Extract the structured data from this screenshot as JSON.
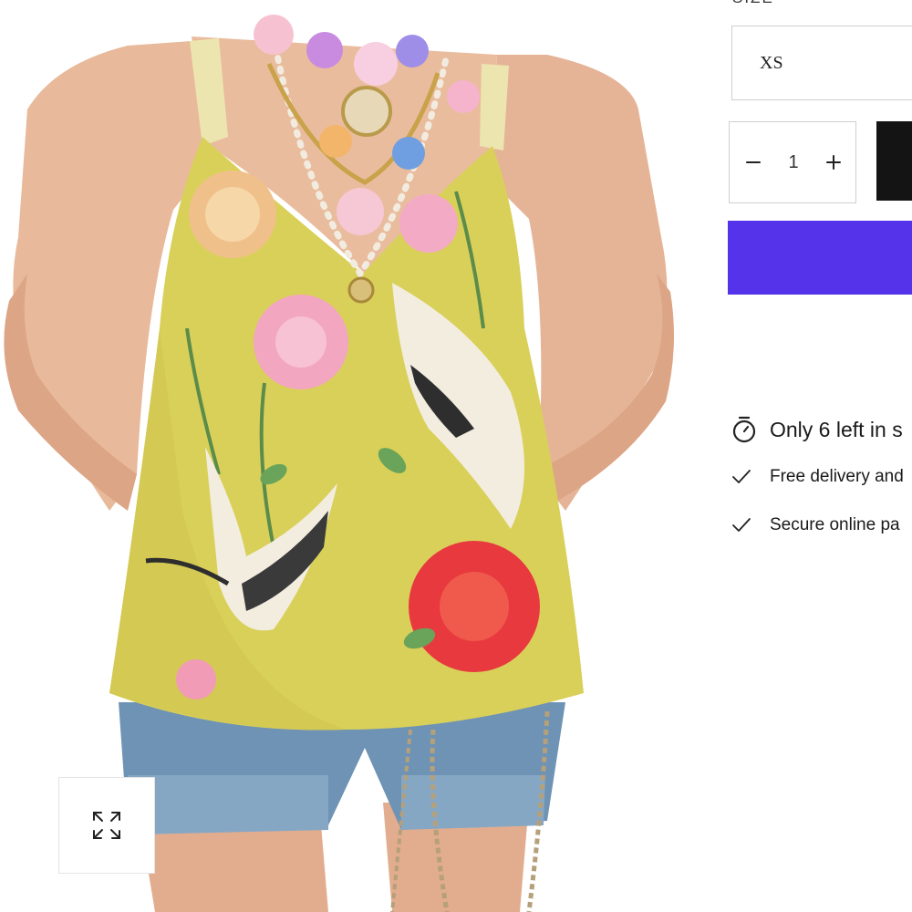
{
  "product": {
    "image_alt": "Yellow floral crane print camisole top worn with denim shorts and flower necklace",
    "zoom_icon": "expand-icon"
  },
  "size_selector": {
    "label": "SIZE",
    "selected": "XS"
  },
  "quantity": {
    "value": "1",
    "minus_icon": "minus-icon",
    "plus_icon": "plus-icon"
  },
  "buttons": {
    "add_to_cart_color": "#141414",
    "buy_now_color": "#5433eb"
  },
  "inventory": {
    "icon": "stopwatch-icon",
    "text": "Only 6 left in s"
  },
  "features": [
    {
      "icon": "check-icon",
      "text": "Free delivery and"
    },
    {
      "icon": "check-icon",
      "text": "Secure online pa"
    }
  ]
}
